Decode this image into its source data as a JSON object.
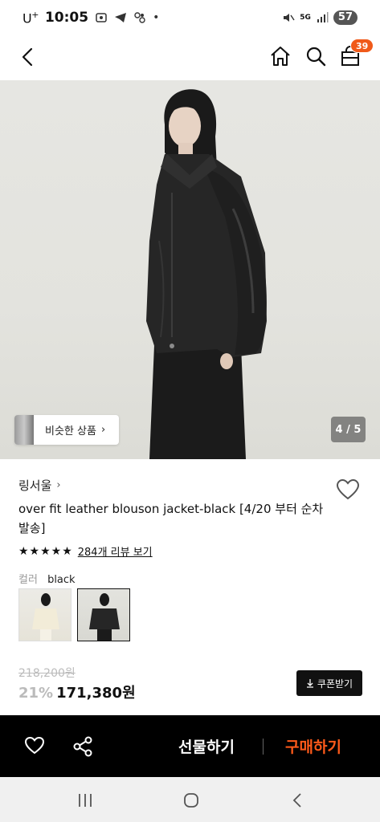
{
  "status": {
    "carrier": "U",
    "carrier_sup": "+",
    "time": "10:05",
    "network": "5G",
    "battery": "57"
  },
  "nav": {
    "cart_count": "39"
  },
  "gallery": {
    "similar_label": "비슷한 상품",
    "pager": "4 / 5"
  },
  "product": {
    "brand": "링서울",
    "title": "over fit leather blouson jacket-black [4/20 부터 순차발송]",
    "stars": "★★★★★",
    "review_link": "284개 리뷰 보기",
    "color_label": "컬러",
    "color_value": "black",
    "original_price": "218,200원",
    "discount": "21%",
    "price": "171,380원",
    "coupon_label": "쿠폰받기"
  },
  "bottom_bar": {
    "gift_label": "선물하기",
    "buy_label": "구매하기"
  },
  "colors": {
    "accent": "#ff5a1a",
    "badge": "#f05a1a"
  }
}
